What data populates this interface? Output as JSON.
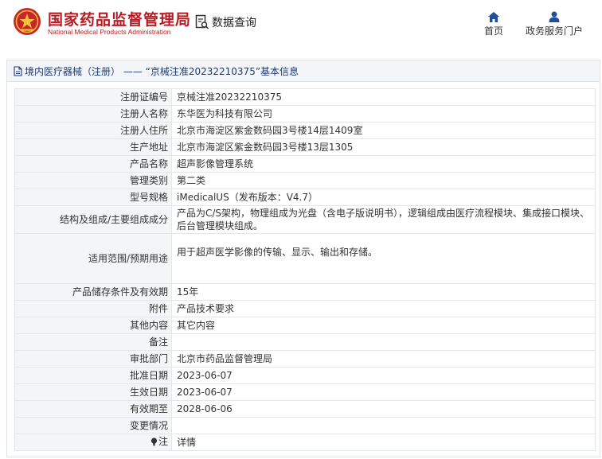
{
  "header": {
    "brand_cn": "国家药品监督管理局",
    "brand_en": "National Medical Products Administration",
    "query_label": "数据查询",
    "nav": [
      {
        "label": "首页",
        "icon": "home-icon"
      },
      {
        "label": "政务服务门户",
        "icon": "user-icon"
      }
    ]
  },
  "panel": {
    "title": "境内医疗器械（注册） —— “京械注准20232210375”基本信息"
  },
  "rows": [
    {
      "label": "注册证编号",
      "value": "京械注准20232210375"
    },
    {
      "label": "注册人名称",
      "value": "东华医为科技有限公司"
    },
    {
      "label": "注册人住所",
      "value": "北京市海淀区紫金数码园3号楼14层1409室"
    },
    {
      "label": "生产地址",
      "value": "北京市海淀区紫金数码园3号楼13层1305"
    },
    {
      "label": "产品名称",
      "value": "超声影像管理系统"
    },
    {
      "label": "管理类别",
      "value": "第二类"
    },
    {
      "label": "型号规格",
      "value": "iMedicalUS（发布版本：V4.7）"
    },
    {
      "label": "结构及组成/主要组成成分",
      "value": "产品为C/S架构，物理组成为光盘（含电子版说明书），逻辑组成由医疗流程模块、集成接口模块、后台管理模块组成。"
    },
    {
      "label": "适用范围/预期用途",
      "value": "用于超声医学影像的传输、显示、输出和存储。"
    },
    {
      "label": "产品储存条件及有效期",
      "value": "15年"
    },
    {
      "label": "附件",
      "value": "产品技术要求"
    },
    {
      "label": "其他内容",
      "value": "其它内容"
    },
    {
      "label": "备注",
      "value": ""
    },
    {
      "label": "审批部门",
      "value": "北京市药品监督管理局"
    },
    {
      "label": "批准日期",
      "value": "2023-06-07"
    },
    {
      "label": "生效日期",
      "value": "2023-06-07"
    },
    {
      "label": "有效期至",
      "value": "2028-06-06"
    },
    {
      "label": "变更情况",
      "value": ""
    },
    {
      "label": "注",
      "value": "详情"
    }
  ]
}
